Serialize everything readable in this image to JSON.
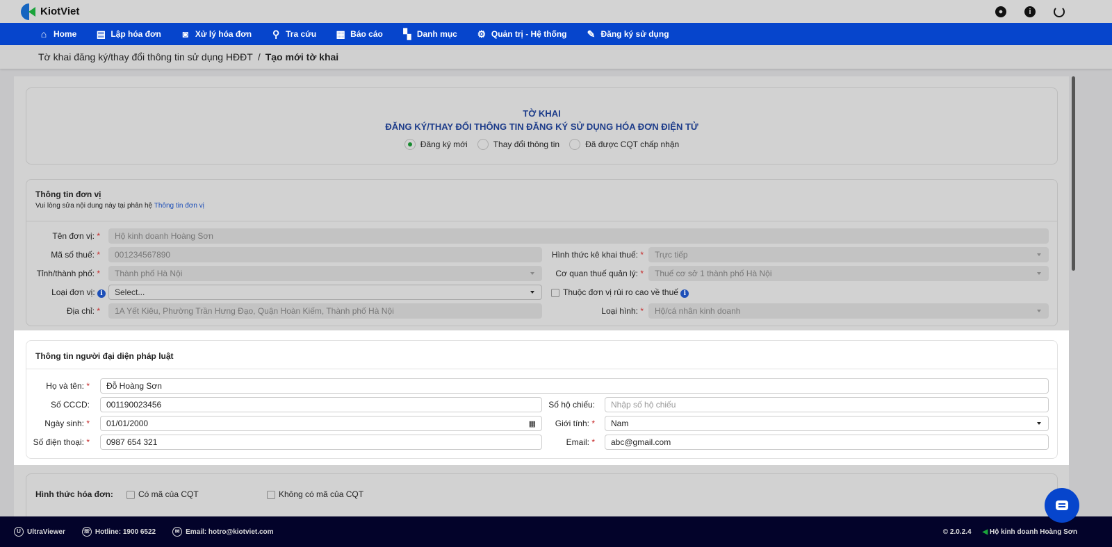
{
  "app": {
    "name": "KiotViet"
  },
  "nav": [
    {
      "label": "Home",
      "icon": "home-icon"
    },
    {
      "label": "Lập hóa đơn",
      "icon": "invoice-add-icon"
    },
    {
      "label": "Xử lý hóa đơn",
      "icon": "invoice-process-icon"
    },
    {
      "label": "Tra cứu",
      "icon": "search-icon"
    },
    {
      "label": "Báo cáo",
      "icon": "report-icon"
    },
    {
      "label": "Danh mục",
      "icon": "grid-icon"
    },
    {
      "label": "Quản trị - Hệ thống",
      "icon": "admin-icon"
    },
    {
      "label": "Đăng ký sử dụng",
      "icon": "register-icon"
    }
  ],
  "breadcrumb": {
    "parent": "Tờ khai đăng ký/thay đổi thông tin sử dụng HĐĐT",
    "sep": "/",
    "current": "Tạo mới tờ khai"
  },
  "form_title": {
    "line1": "TỜ KHAI",
    "line2": "ĐĂNG KÝ/THAY ĐỔI THÔNG TIN ĐĂNG KÝ SỬ DỤNG HÓA ĐƠN ĐIỆN TỬ",
    "options": [
      "Đăng ký mới",
      "Thay đổi thông tin",
      "Đã được CQT chấp nhận"
    ],
    "selected": 0
  },
  "unit": {
    "title": "Thông tin đơn vị",
    "note": "Vui lòng sửa nội dung này tại phân hệ",
    "note_link": "Thông tin đơn vị",
    "name_label": "Tên đơn vị:",
    "name": "Hộ kinh doanh Hoàng Sơn",
    "tax_label": "Mã số thuế:",
    "tax": "001234567890",
    "city_label": "Tỉnh/thành phố:",
    "city": "Thành phố Hà Nội",
    "type_label": "Loại đơn vị:",
    "type": "Select...",
    "addr_label": "Địa chỉ:",
    "addr": "1A Yết Kiêu, Phường Trần Hưng Đạo, Quận Hoàn Kiếm, Thành phố Hà Nội",
    "form_label": "Hình thức kê khai thuế:",
    "form": "Trực tiếp",
    "office_label": "Cơ quan thuế quản lý:",
    "office": "Thuế cơ sở 1 thành phố Hà Nội",
    "risk_label": "Thuộc đơn vị rủi ro cao về thuế",
    "kind_label": "Loại hình:",
    "kind": "Hộ/cá nhân kinh doanh"
  },
  "rep": {
    "title": "Thông tin người đại diện pháp luật",
    "name_label": "Họ và tên:",
    "name": "Đỗ Hoàng Sơn",
    "id_label": "Số CCCD:",
    "id": "001190023456",
    "dob_label": "Ngày sinh:",
    "dob": "01/01/2000",
    "phone_label": "Số điện thoại:",
    "phone": "0987 654 321",
    "passport_label": "Số hộ chiếu:",
    "passport_placeholder": "Nhập số hộ chiếu",
    "gender_label": "Giới tính:",
    "gender": "Nam",
    "email_label": "Email:",
    "email": "abc@gmail.com"
  },
  "invoice_form": {
    "label": "Hình thức hóa đơn:",
    "options": [
      "Có mã của CQT",
      "Không có mã của CQT"
    ]
  },
  "footer": {
    "ultraviewer": "UltraViewer",
    "hotline": "Hotline: 1900 6522",
    "email": "Email: hotro@kiotviet.com",
    "version": "2.0.2.4",
    "company": "Hộ kinh doanh Hoàng Sơn"
  }
}
